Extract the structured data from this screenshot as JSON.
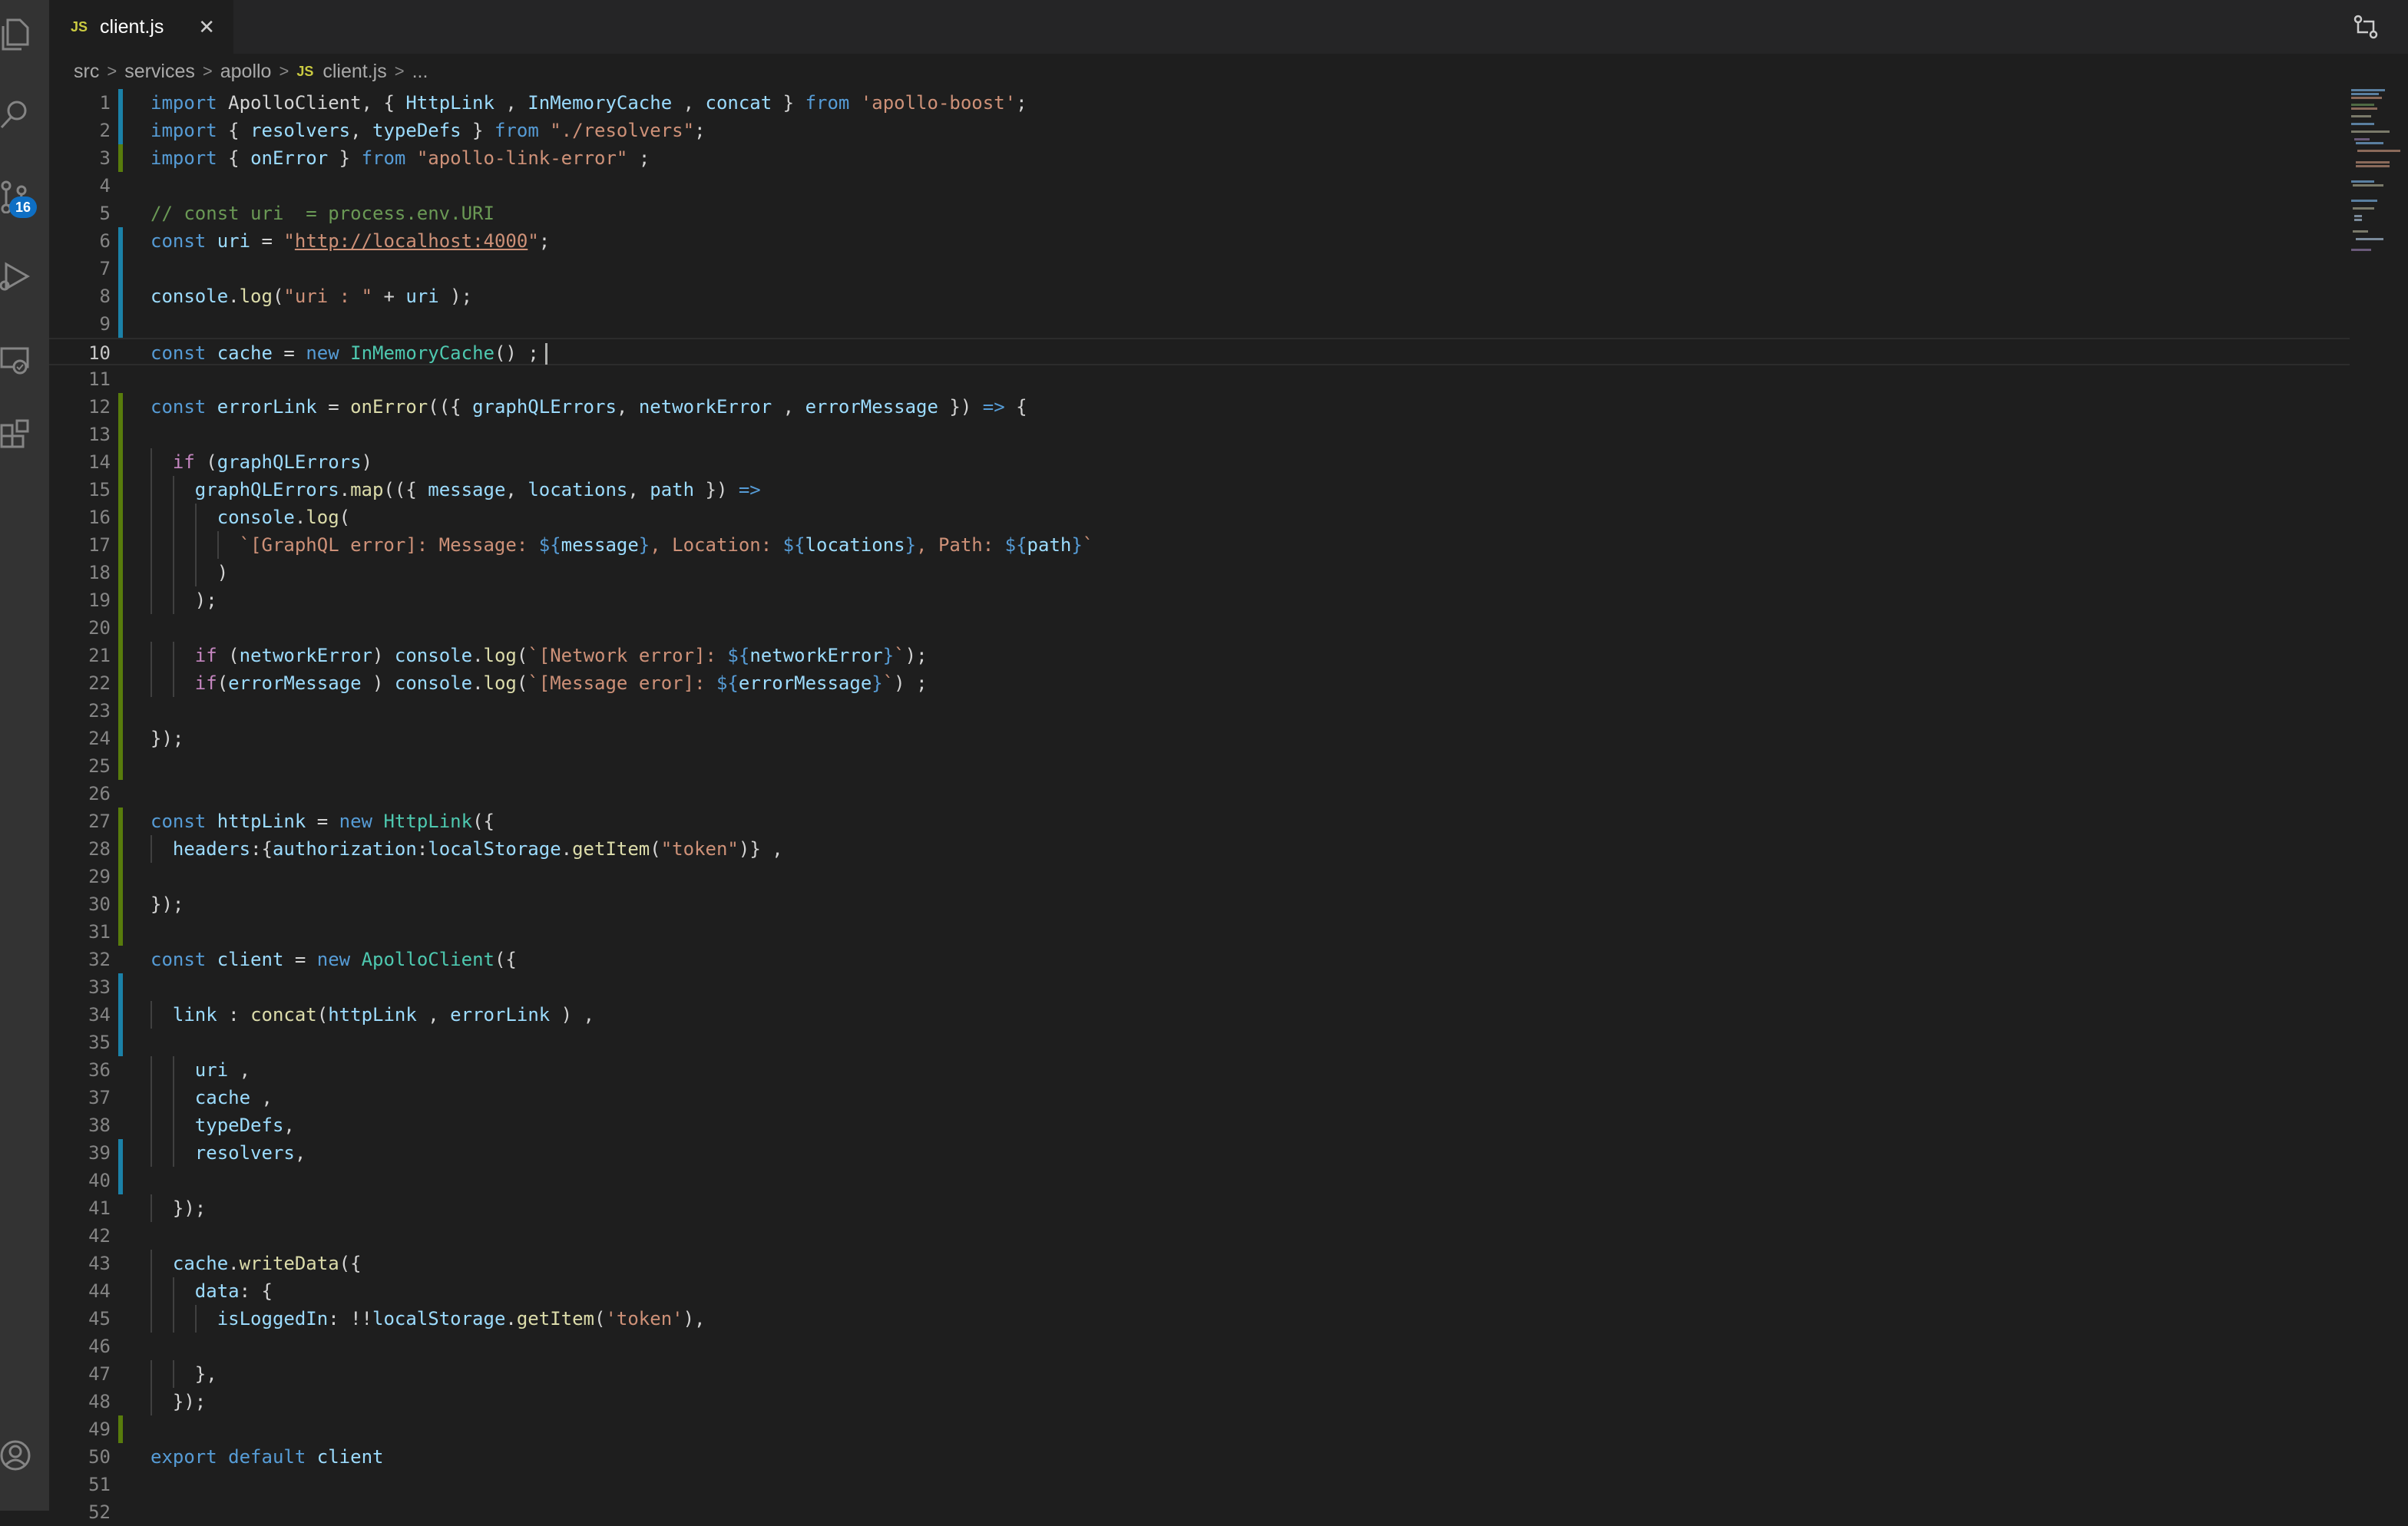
{
  "tabs": [
    {
      "label": "client.js",
      "icon": "JS",
      "active": true
    }
  ],
  "activity_bar": {
    "items": [
      "explorer-icon",
      "search-icon",
      "source-control-icon",
      "run-debug-icon",
      "remote-explorer-icon",
      "extensions-icon",
      "accounts-icon"
    ],
    "source_control_badge": "16"
  },
  "breadcrumb": {
    "parts": [
      "src",
      "services",
      "apollo"
    ],
    "file_icon": "JS",
    "file": "client.js",
    "ellipsis": "..."
  },
  "editor": {
    "cursor_line": 10,
    "lines": [
      {
        "n": "1",
        "git": "modified",
        "tokens": [
          [
            "kw",
            "import"
          ],
          [
            "t",
            " ApolloClient, { "
          ],
          [
            "v",
            "HttpLink"
          ],
          [
            "t",
            " , "
          ],
          [
            "v",
            "InMemoryCache"
          ],
          [
            "t",
            " , "
          ],
          [
            "v",
            "concat"
          ],
          [
            "t",
            " } "
          ],
          [
            "kw",
            "from"
          ],
          [
            "t",
            " "
          ],
          [
            "s",
            "'apollo-boost'"
          ],
          [
            "t",
            ";"
          ]
        ]
      },
      {
        "n": "2",
        "git": "modified",
        "tokens": [
          [
            "kw",
            "import"
          ],
          [
            "t",
            " { "
          ],
          [
            "v",
            "resolvers"
          ],
          [
            "t",
            ", "
          ],
          [
            "v",
            "typeDefs"
          ],
          [
            "t",
            " } "
          ],
          [
            "kw",
            "from"
          ],
          [
            "t",
            " "
          ],
          [
            "s",
            "\"./resolvers\""
          ],
          [
            "t",
            ";"
          ]
        ]
      },
      {
        "n": "3",
        "git": "added",
        "tokens": [
          [
            "kw",
            "import"
          ],
          [
            "t",
            " { "
          ],
          [
            "v",
            "onError"
          ],
          [
            "t",
            " } "
          ],
          [
            "kw",
            "from"
          ],
          [
            "t",
            " "
          ],
          [
            "s",
            "\"apollo-link-error\""
          ],
          [
            "t",
            " ;"
          ]
        ]
      },
      {
        "n": "4",
        "git": "",
        "tokens": []
      },
      {
        "n": "5",
        "git": "",
        "tokens": [
          [
            "c",
            "// const uri  = process.env.URI"
          ]
        ]
      },
      {
        "n": "6",
        "git": "modified",
        "tokens": [
          [
            "kw",
            "const"
          ],
          [
            "t",
            " "
          ],
          [
            "v",
            "uri"
          ],
          [
            "t",
            " = "
          ],
          [
            "s",
            "\""
          ],
          [
            "u",
            "http://localhost:4000"
          ],
          [
            "s",
            "\""
          ],
          [
            "t",
            ";"
          ]
        ]
      },
      {
        "n": "7",
        "git": "modified",
        "tokens": []
      },
      {
        "n": "8",
        "git": "modified",
        "tokens": [
          [
            "v",
            "console"
          ],
          [
            "t",
            "."
          ],
          [
            "f",
            "log"
          ],
          [
            "t",
            "("
          ],
          [
            "s",
            "\"uri : \""
          ],
          [
            "t",
            " + "
          ],
          [
            "v",
            "uri"
          ],
          [
            "t",
            " );"
          ]
        ]
      },
      {
        "n": "9",
        "git": "modified",
        "tokens": []
      },
      {
        "n": "10",
        "git": "",
        "tokens": [
          [
            "kw",
            "const"
          ],
          [
            "t",
            " "
          ],
          [
            "v",
            "cache"
          ],
          [
            "t",
            " = "
          ],
          [
            "kw",
            "new"
          ],
          [
            "t",
            " "
          ],
          [
            "cl",
            "InMemoryCache"
          ],
          [
            "t",
            "() ;"
          ]
        ]
      },
      {
        "n": "11",
        "git": "",
        "tokens": []
      },
      {
        "n": "12",
        "git": "added",
        "tokens": [
          [
            "kw",
            "const"
          ],
          [
            "t",
            " "
          ],
          [
            "v",
            "errorLink"
          ],
          [
            "t",
            " = "
          ],
          [
            "f",
            "onError"
          ],
          [
            "t",
            "(({ "
          ],
          [
            "v",
            "graphQLErrors"
          ],
          [
            "t",
            ", "
          ],
          [
            "v",
            "networkError"
          ],
          [
            "t",
            " , "
          ],
          [
            "v",
            "errorMessage"
          ],
          [
            "t",
            " }) "
          ],
          [
            "kw",
            "=>"
          ],
          [
            "t",
            " {"
          ]
        ]
      },
      {
        "n": "13",
        "git": "added",
        "tokens": []
      },
      {
        "n": "14",
        "git": "added",
        "tokens": [
          [
            "t",
            "  "
          ],
          [
            "ctl",
            "if"
          ],
          [
            "t",
            " ("
          ],
          [
            "v",
            "graphQLErrors"
          ],
          [
            "t",
            ")"
          ]
        ]
      },
      {
        "n": "15",
        "git": "added",
        "tokens": [
          [
            "t",
            "    "
          ],
          [
            "v",
            "graphQLErrors"
          ],
          [
            "t",
            "."
          ],
          [
            "f",
            "map"
          ],
          [
            "t",
            "(({ "
          ],
          [
            "v",
            "message"
          ],
          [
            "t",
            ", "
          ],
          [
            "v",
            "locations"
          ],
          [
            "t",
            ", "
          ],
          [
            "v",
            "path"
          ],
          [
            "t",
            " }) "
          ],
          [
            "kw",
            "=>"
          ]
        ]
      },
      {
        "n": "16",
        "git": "added",
        "tokens": [
          [
            "t",
            "      "
          ],
          [
            "v",
            "console"
          ],
          [
            "t",
            "."
          ],
          [
            "f",
            "log"
          ],
          [
            "t",
            "("
          ]
        ]
      },
      {
        "n": "17",
        "git": "added",
        "tokens": [
          [
            "t",
            "        "
          ],
          [
            "s",
            "`[GraphQL error]: Message: "
          ],
          [
            "kw",
            "${"
          ],
          [
            "v",
            "message"
          ],
          [
            "kw",
            "}"
          ],
          [
            "s",
            ", Location: "
          ],
          [
            "kw",
            "${"
          ],
          [
            "v",
            "locations"
          ],
          [
            "kw",
            "}"
          ],
          [
            "s",
            ", Path: "
          ],
          [
            "kw",
            "${"
          ],
          [
            "v",
            "path"
          ],
          [
            "kw",
            "}"
          ],
          [
            "s",
            "`"
          ]
        ]
      },
      {
        "n": "18",
        "git": "added",
        "tokens": [
          [
            "t",
            "      )"
          ]
        ]
      },
      {
        "n": "19",
        "git": "added",
        "tokens": [
          [
            "t",
            "    );"
          ]
        ]
      },
      {
        "n": "20",
        "git": "added",
        "tokens": []
      },
      {
        "n": "21",
        "git": "added",
        "tokens": [
          [
            "t",
            "    "
          ],
          [
            "ctl",
            "if"
          ],
          [
            "t",
            " ("
          ],
          [
            "v",
            "networkError"
          ],
          [
            "t",
            ") "
          ],
          [
            "v",
            "console"
          ],
          [
            "t",
            "."
          ],
          [
            "f",
            "log"
          ],
          [
            "t",
            "("
          ],
          [
            "s",
            "`[Network error]: "
          ],
          [
            "kw",
            "${"
          ],
          [
            "v",
            "networkError"
          ],
          [
            "kw",
            "}"
          ],
          [
            "s",
            "`"
          ],
          [
            "t",
            ");"
          ]
        ]
      },
      {
        "n": "22",
        "git": "added",
        "tokens": [
          [
            "t",
            "    "
          ],
          [
            "ctl",
            "if"
          ],
          [
            "t",
            "("
          ],
          [
            "v",
            "errorMessage"
          ],
          [
            "t",
            " ) "
          ],
          [
            "v",
            "console"
          ],
          [
            "t",
            "."
          ],
          [
            "f",
            "log"
          ],
          [
            "t",
            "("
          ],
          [
            "s",
            "`[Message eror]: "
          ],
          [
            "kw",
            "${"
          ],
          [
            "v",
            "errorMessage"
          ],
          [
            "kw",
            "}"
          ],
          [
            "s",
            "`"
          ],
          [
            "t",
            ") ;"
          ]
        ]
      },
      {
        "n": "23",
        "git": "added",
        "tokens": []
      },
      {
        "n": "24",
        "git": "added",
        "tokens": [
          [
            "t",
            "});"
          ]
        ]
      },
      {
        "n": "25",
        "git": "added",
        "tokens": []
      },
      {
        "n": "26",
        "git": "",
        "tokens": []
      },
      {
        "n": "27",
        "git": "added",
        "tokens": [
          [
            "kw",
            "const"
          ],
          [
            "t",
            " "
          ],
          [
            "v",
            "httpLink"
          ],
          [
            "t",
            " = "
          ],
          [
            "kw",
            "new"
          ],
          [
            "t",
            " "
          ],
          [
            "cl",
            "HttpLink"
          ],
          [
            "t",
            "({"
          ]
        ]
      },
      {
        "n": "28",
        "git": "added",
        "tokens": [
          [
            "t",
            "  "
          ],
          [
            "v",
            "headers"
          ],
          [
            "t",
            ":{"
          ],
          [
            "v",
            "authorization"
          ],
          [
            "t",
            ":"
          ],
          [
            "v",
            "localStorage"
          ],
          [
            "t",
            "."
          ],
          [
            "f",
            "getItem"
          ],
          [
            "t",
            "("
          ],
          [
            "s",
            "\"token\""
          ],
          [
            "t",
            ")} ,"
          ]
        ]
      },
      {
        "n": "29",
        "git": "added",
        "tokens": []
      },
      {
        "n": "30",
        "git": "added",
        "tokens": [
          [
            "t",
            "});"
          ]
        ]
      },
      {
        "n": "31",
        "git": "added",
        "tokens": []
      },
      {
        "n": "32",
        "git": "",
        "tokens": [
          [
            "kw",
            "const"
          ],
          [
            "t",
            " "
          ],
          [
            "v",
            "client"
          ],
          [
            "t",
            " = "
          ],
          [
            "kw",
            "new"
          ],
          [
            "t",
            " "
          ],
          [
            "cl",
            "ApolloClient"
          ],
          [
            "t",
            "({"
          ]
        ]
      },
      {
        "n": "33",
        "git": "modified",
        "tokens": []
      },
      {
        "n": "34",
        "git": "modified",
        "tokens": [
          [
            "t",
            "  "
          ],
          [
            "v",
            "link"
          ],
          [
            "t",
            " : "
          ],
          [
            "f",
            "concat"
          ],
          [
            "t",
            "("
          ],
          [
            "v",
            "httpLink"
          ],
          [
            "t",
            " , "
          ],
          [
            "v",
            "errorLink"
          ],
          [
            "t",
            " ) ,"
          ]
        ]
      },
      {
        "n": "35",
        "git": "modified",
        "tokens": []
      },
      {
        "n": "36",
        "git": "",
        "tokens": [
          [
            "t",
            "    "
          ],
          [
            "v",
            "uri"
          ],
          [
            "t",
            " ,"
          ]
        ]
      },
      {
        "n": "37",
        "git": "",
        "tokens": [
          [
            "t",
            "    "
          ],
          [
            "v",
            "cache"
          ],
          [
            "t",
            " ,"
          ]
        ]
      },
      {
        "n": "38",
        "git": "",
        "tokens": [
          [
            "t",
            "    "
          ],
          [
            "v",
            "typeDefs"
          ],
          [
            "t",
            ","
          ]
        ]
      },
      {
        "n": "39",
        "git": "modified",
        "tokens": [
          [
            "t",
            "    "
          ],
          [
            "v",
            "resolvers"
          ],
          [
            "t",
            ","
          ]
        ]
      },
      {
        "n": "40",
        "git": "modified",
        "tokens": []
      },
      {
        "n": "41",
        "git": "",
        "tokens": [
          [
            "t",
            "  });"
          ]
        ]
      },
      {
        "n": "42",
        "git": "",
        "tokens": []
      },
      {
        "n": "43",
        "git": "",
        "tokens": [
          [
            "t",
            "  "
          ],
          [
            "v",
            "cache"
          ],
          [
            "t",
            "."
          ],
          [
            "f",
            "writeData"
          ],
          [
            "t",
            "({"
          ]
        ]
      },
      {
        "n": "44",
        "git": "",
        "tokens": [
          [
            "t",
            "    "
          ],
          [
            "v",
            "data"
          ],
          [
            "t",
            ": {"
          ]
        ]
      },
      {
        "n": "45",
        "git": "",
        "tokens": [
          [
            "t",
            "      "
          ],
          [
            "v",
            "isLoggedIn"
          ],
          [
            "t",
            ": !!"
          ],
          [
            "v",
            "localStorage"
          ],
          [
            "t",
            "."
          ],
          [
            "f",
            "getItem"
          ],
          [
            "t",
            "("
          ],
          [
            "s",
            "'token'"
          ],
          [
            "t",
            "),"
          ]
        ]
      },
      {
        "n": "46",
        "git": "",
        "tokens": []
      },
      {
        "n": "47",
        "git": "",
        "tokens": [
          [
            "t",
            "    },"
          ]
        ]
      },
      {
        "n": "48",
        "git": "",
        "tokens": [
          [
            "t",
            "  });"
          ]
        ]
      },
      {
        "n": "49",
        "git": "added",
        "tokens": []
      },
      {
        "n": "50",
        "git": "",
        "tokens": [
          [
            "kw",
            "export"
          ],
          [
            "t",
            " "
          ],
          [
            "kw",
            "default"
          ],
          [
            "t",
            " "
          ],
          [
            "v",
            "client"
          ]
        ]
      },
      {
        "n": "51",
        "git": "",
        "tokens": []
      },
      {
        "n": "52",
        "git": "",
        "tokens": []
      }
    ]
  },
  "colors": {
    "background": "#1e1e1e",
    "activity_bar": "#333333",
    "keyword": "#569cd6",
    "control": "#c586c0",
    "variable": "#9cdcfe",
    "class": "#4ec9b0",
    "function": "#dcdcaa",
    "string": "#ce9178",
    "comment": "#6a9955",
    "git_modified": "#1b81a8",
    "git_added": "#587c0c",
    "badge": "#0e6fc4"
  }
}
